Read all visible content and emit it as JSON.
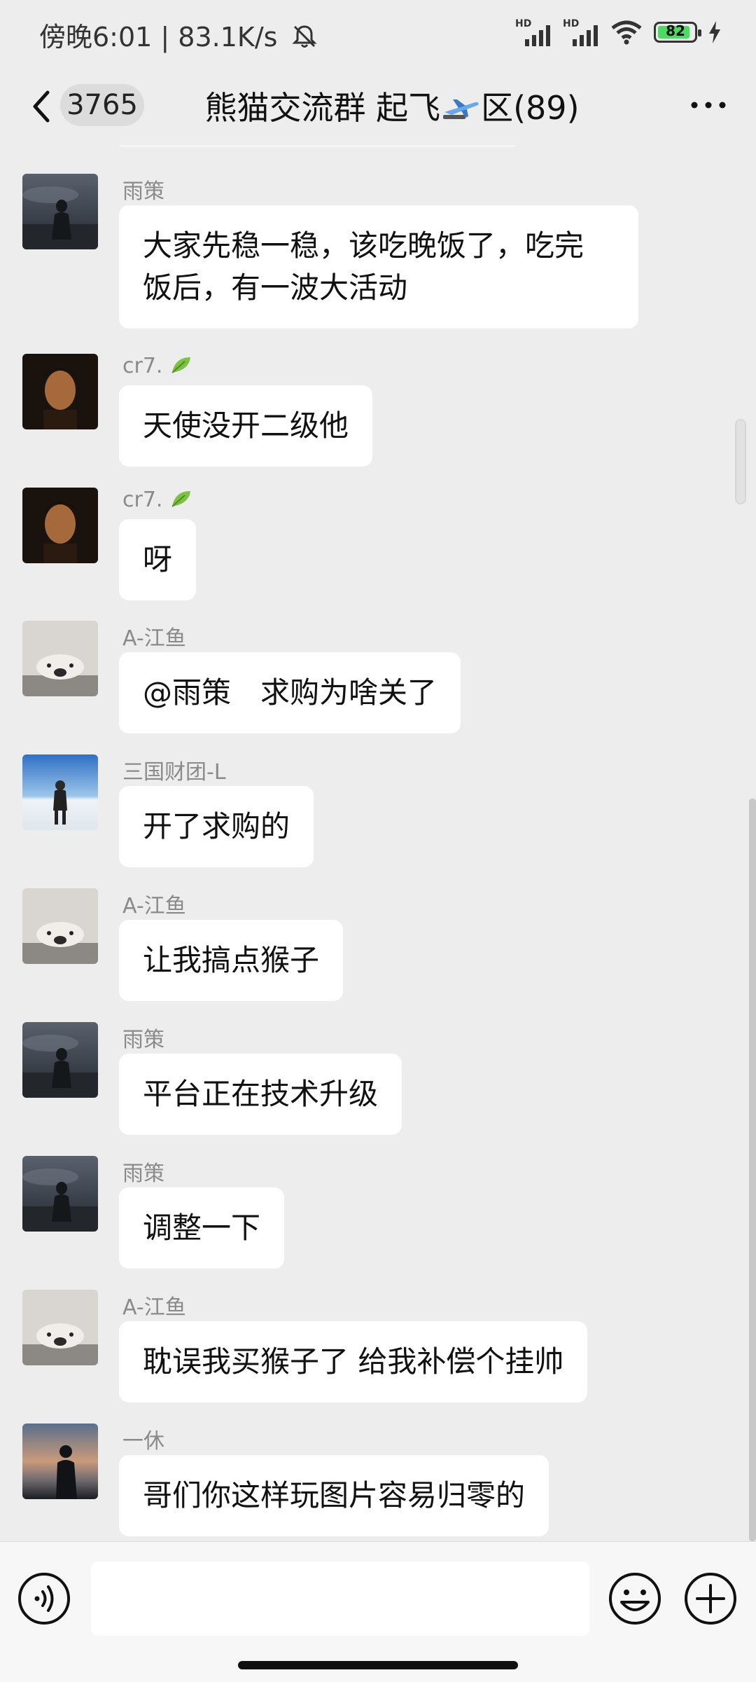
{
  "status": {
    "time": "傍晚6:01 | 83.1K/s",
    "signal1": "HD",
    "signal2": "HD",
    "battery": "82"
  },
  "header": {
    "unread_count": "3765",
    "title_a": "熊猫交流群 起飞",
    "title_b": "区(89)"
  },
  "messages": [
    {
      "name": "雨策",
      "text1": "大家先稳一稳，该吃晚饭了，吃完",
      "text2": "饭后，有一波大活动"
    },
    {
      "name": "cr7.",
      "text": "天使没开二级他"
    },
    {
      "name": "cr7.",
      "text": "呀"
    },
    {
      "name": "A-江鱼",
      "text": "@雨策　求购为啥关了"
    },
    {
      "name": "三国财团-L",
      "text": "开了求购的"
    },
    {
      "name": "A-江鱼",
      "text": "让我搞点猴子"
    },
    {
      "name": "雨策",
      "text": "平台正在技术升级"
    },
    {
      "name": "雨策",
      "text": "调整一下"
    },
    {
      "name": "A-江鱼",
      "text": "耽误我买猴子了  给我补偿个挂帅"
    },
    {
      "name": "一休",
      "text": "哥们你这样玩图片容易归零的"
    }
  ],
  "colors": {
    "background": "#ededed",
    "bubble": "#ffffff",
    "name": "#8a8a8a",
    "battery_fill": "#4cd964"
  }
}
